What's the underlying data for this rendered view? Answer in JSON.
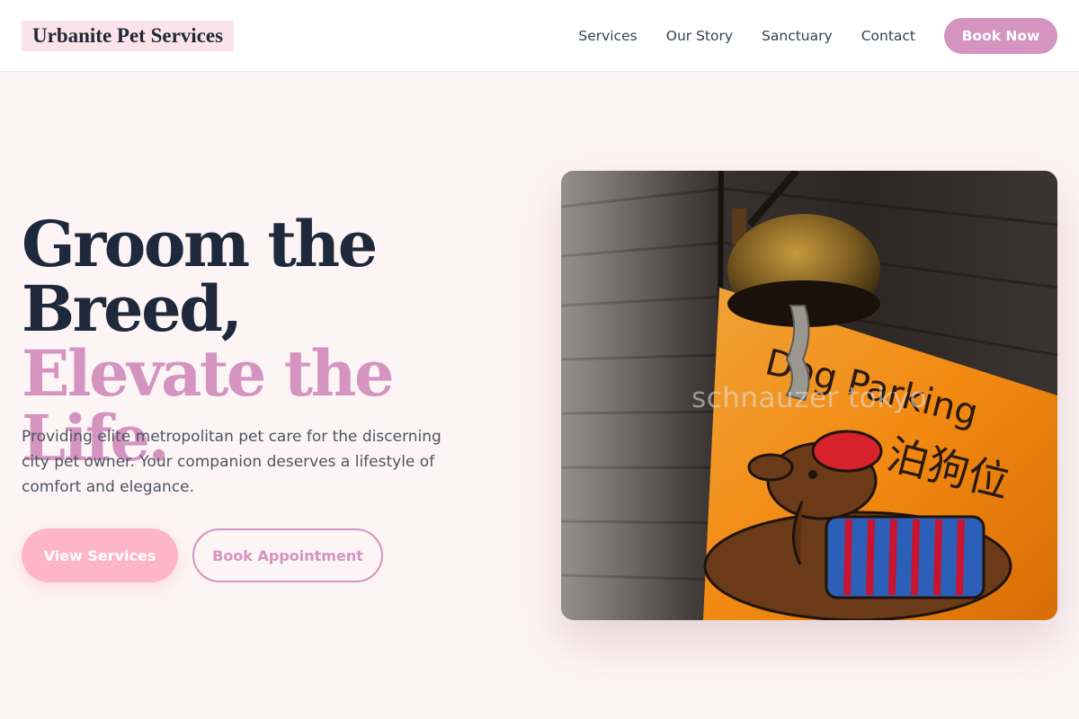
{
  "brand": {
    "name": "Urbanite Pet Services",
    "accent_color": "#d494bf",
    "button_pink": "#ffb5c8",
    "background": "#fdf4f5"
  },
  "nav": {
    "links": [
      "Services",
      "Our Story",
      "Sanctuary",
      "Contact"
    ],
    "cta": "Book Now"
  },
  "hero": {
    "headline_line1": "Groom the",
    "headline_line2": "Breed,",
    "headline_line3": "Elevate the Life.",
    "description": "Providing elite metropolitan pet care for the discerning city pet owner. Your companion deserves a lifestyle of comfort and elegance.",
    "primary_button": "View Services",
    "secondary_button": "Book Appointment",
    "image_watermark": "schnauzer tokyo",
    "sign_text_line1": "Dog Parking",
    "sign_text_line2": "泊狗位"
  }
}
